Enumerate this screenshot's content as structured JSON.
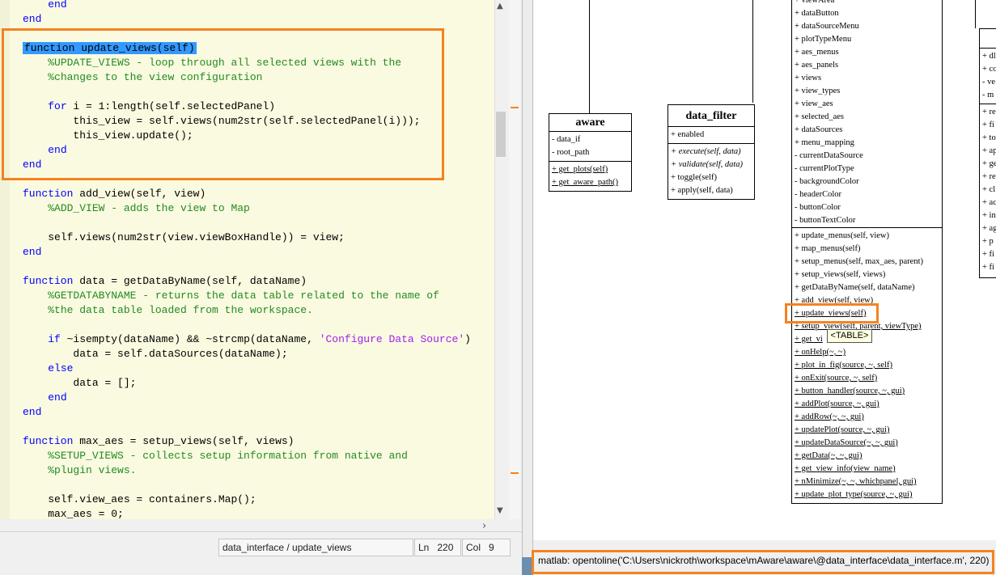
{
  "editor": {
    "lines": [
      [
        {
          "t": "    "
        },
        {
          "t": "end",
          "c": "kw"
        }
      ],
      [
        {
          "t": "end",
          "c": "kw"
        }
      ],
      [
        {
          "t": ""
        }
      ],
      [
        {
          "t": "function update_views(self)",
          "c": "sel"
        }
      ],
      [
        {
          "t": "    "
        },
        {
          "t": "%UPDATE_VIEWS - loop through all selected views with the",
          "c": "cm"
        }
      ],
      [
        {
          "t": "    "
        },
        {
          "t": "%changes to the view configuration",
          "c": "cm"
        }
      ],
      [
        {
          "t": ""
        }
      ],
      [
        {
          "t": "    "
        },
        {
          "t": "for",
          "c": "kw"
        },
        {
          "t": " i = 1:length(self.selectedPanel)"
        }
      ],
      [
        {
          "t": "        this_view = self.views(num2str(self.selectedPanel(i)));"
        }
      ],
      [
        {
          "t": "        this_view.update();"
        }
      ],
      [
        {
          "t": "    "
        },
        {
          "t": "end",
          "c": "kw"
        }
      ],
      [
        {
          "t": "end",
          "c": "kw"
        }
      ],
      [
        {
          "t": ""
        }
      ],
      [
        {
          "t": "function",
          "c": "kw"
        },
        {
          "t": " add_view(self, view)"
        }
      ],
      [
        {
          "t": "    "
        },
        {
          "t": "%ADD_VIEW - adds the view to Map",
          "c": "cm"
        }
      ],
      [
        {
          "t": ""
        }
      ],
      [
        {
          "t": "    self.views(num2str(view.viewBoxHandle)) = view;"
        }
      ],
      [
        {
          "t": "end",
          "c": "kw"
        }
      ],
      [
        {
          "t": ""
        }
      ],
      [
        {
          "t": "function",
          "c": "kw"
        },
        {
          "t": " data = getDataByName(self, dataName)"
        }
      ],
      [
        {
          "t": "    "
        },
        {
          "t": "%GETDATABYNAME - returns the data table related to the name of",
          "c": "cm"
        }
      ],
      [
        {
          "t": "    "
        },
        {
          "t": "%the data table loaded from the workspace.",
          "c": "cm"
        }
      ],
      [
        {
          "t": ""
        }
      ],
      [
        {
          "t": "    "
        },
        {
          "t": "if",
          "c": "kw"
        },
        {
          "t": " ~isempty(dataName) && ~strcmp(dataName, "
        },
        {
          "t": "'Configure Data Source'",
          "c": "st"
        },
        {
          "t": ")"
        }
      ],
      [
        {
          "t": "        data = self.dataSources(dataName);"
        }
      ],
      [
        {
          "t": "    "
        },
        {
          "t": "else",
          "c": "kw"
        }
      ],
      [
        {
          "t": "        data = [];"
        }
      ],
      [
        {
          "t": "    "
        },
        {
          "t": "end",
          "c": "kw"
        }
      ],
      [
        {
          "t": "end",
          "c": "kw"
        }
      ],
      [
        {
          "t": ""
        }
      ],
      [
        {
          "t": "function",
          "c": "kw"
        },
        {
          "t": " max_aes = setup_views(self, views)"
        }
      ],
      [
        {
          "t": "    "
        },
        {
          "t": "%SETUP_VIEWS - collects setup information from native and",
          "c": "cm"
        }
      ],
      [
        {
          "t": "    "
        },
        {
          "t": "%plugin views.",
          "c": "cm"
        }
      ],
      [
        {
          "t": ""
        }
      ],
      [
        {
          "t": "    self.view_aes = containers.Map();"
        }
      ],
      [
        {
          "t": "    max_aes = 0;"
        }
      ]
    ]
  },
  "status": {
    "location": "data_interface / update_views",
    "ln_label": "Ln",
    "ln_value": "220",
    "col_label": "Col",
    "col_value": "9"
  },
  "diagram": {
    "aware": {
      "title": "aware",
      "attributes": [
        "- data_if",
        "- root_path"
      ],
      "methods": [
        "+ get_plots(self)",
        "+ get_aware_path()"
      ]
    },
    "data_filter": {
      "title": "data_filter",
      "attributes": [
        "+ enabled"
      ],
      "methods": [
        "+ execute(self, data)",
        "+ validate(self, data)",
        "+ toggle(self)",
        "+ apply(self, data)"
      ]
    },
    "data_interface": {
      "attributes": [
        "+ viewArea",
        "+ dataButton",
        "+ dataSourceMenu",
        "+ plotTypeMenu",
        "+ aes_menus",
        "+ aes_panels",
        "+ views",
        "+ view_types",
        "+ view_aes",
        "+ selected_aes",
        "+ dataSources",
        "+ menu_mapping",
        "- currentDataSource",
        "- currentPlotType",
        "- backgroundColor",
        "- headerColor",
        "- buttonColor",
        "- buttonTextColor"
      ],
      "methods": [
        "+ update_menus(self, view)",
        "+ map_menus(self)",
        "+ setup_menus(self, max_aes, parent)",
        "+ setup_views(self, views)",
        "+ getDataByName(self, dataName)",
        "+ add_view(self, view)",
        "+ update_views(self)",
        "+ setup_view(self, parent, viewType)",
        "+ get_vi",
        "+ onHelp(~, ~)",
        "+ plot_in_fig(source, ~, self)",
        "+ onExit(source, ~, self)",
        "+ button_handler(source, ~, gui)",
        "+ addPlot(source, ~, gui)",
        "+ addRow(~, ~, gui)",
        "+ updatePlot(source, ~, gui)",
        "+ updateDataSource(~, ~, gui)",
        "+ getData(~, ~, gui)",
        "+ get_view_info(view_name)",
        "+ nMinimize(~, ~, whichpanel, gui)",
        "+ update_plot_type(source, ~, gui)"
      ]
    },
    "partial_class": {
      "attributes": [
        "+ dl",
        "+ co",
        "- ve",
        "- m"
      ],
      "methods": [
        "+ re",
        "+ fi",
        "+ to",
        "+ ap",
        "+ ge",
        "+ re",
        "+ cl",
        "+ ac",
        "+ in",
        "+ ag",
        "+ p",
        "+ fi",
        "+ fi"
      ]
    },
    "tooltip": "<TABLE>"
  },
  "command": {
    "text": "matlab: opentoline('C:\\Users\\nickroth\\workspace\\mAware\\aware\\@data_interface\\data_interface.m', 220)"
  },
  "colors": {
    "highlight": "#f58220",
    "keyword": "#0000ff",
    "comment": "#228b22",
    "string": "#a020f0",
    "selection": "#3399ff"
  }
}
